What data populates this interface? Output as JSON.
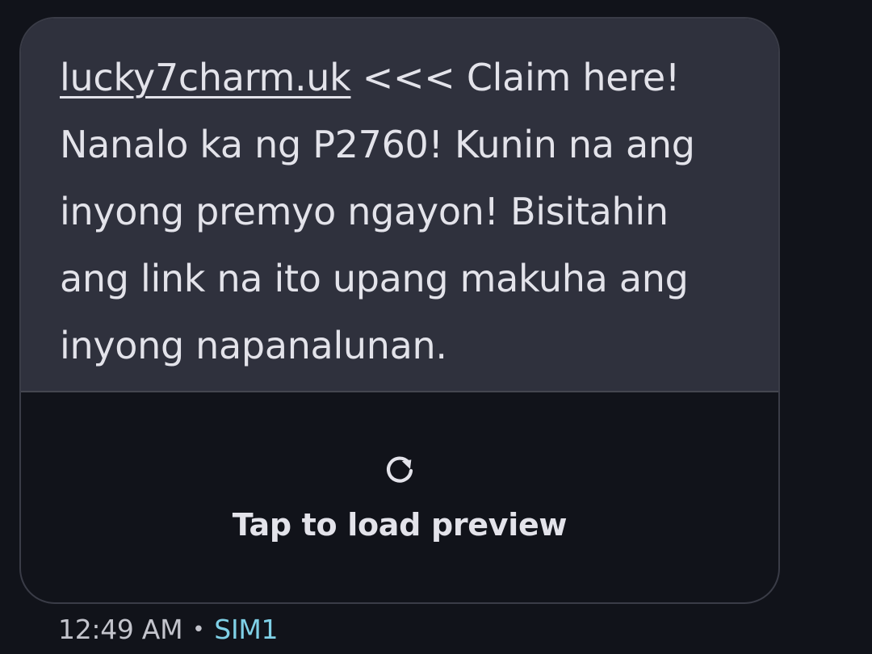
{
  "message": {
    "link": "lucky7charm.uk",
    "after_link": " <<< Claim here!",
    "line2": "Nanalo ka ng P2760! Kunin na ang",
    "line3": "inyong premyo ngayon! Bisitahin",
    "line4": "ang link na ito upang makuha ang",
    "line5": "inyong napanalunan."
  },
  "preview": {
    "icon": "refresh-icon",
    "label": "Tap to load preview"
  },
  "meta": {
    "time": "12:49 AM",
    "separator": "•",
    "sim": "SIM1"
  },
  "colors": {
    "background": "#11131a",
    "bubble": "#2f313d",
    "text": "#e3e3ea",
    "sim_accent": "#7fd0e6"
  }
}
